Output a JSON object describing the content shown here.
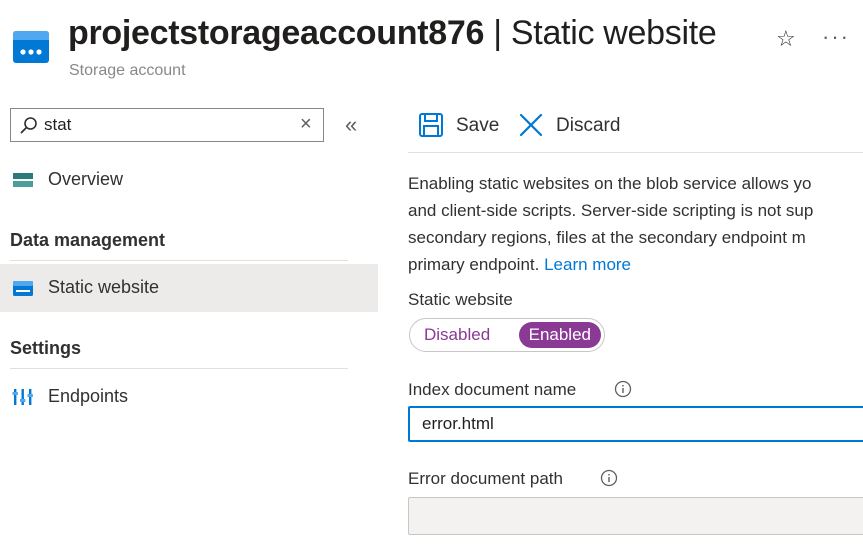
{
  "header": {
    "resource_name": "projectstorageaccount876",
    "separator": "|",
    "page_title": "Static website",
    "subtitle": "Storage account",
    "favorite_icon": "star-icon",
    "more_icon": "more-icon",
    "more_glyph": "···"
  },
  "sidebar": {
    "search": {
      "value": "stat",
      "icon": "search-icon"
    },
    "collapse_glyph": "«",
    "items": [
      {
        "label": "Overview",
        "icon": "overview-icon"
      },
      {
        "label": "Static website",
        "icon": "static-website-icon",
        "selected": true
      },
      {
        "label": "Endpoints",
        "icon": "endpoints-icon"
      }
    ],
    "groups": {
      "data": "Data management",
      "settings": "Settings"
    }
  },
  "toolbar": {
    "save_label": "Save",
    "discard_label": "Discard"
  },
  "main": {
    "description_lines": [
      "Enabling static websites on the blob service allows yo",
      "and client-side scripts. Server-side scripting is not sup",
      "secondary regions, files at the secondary endpoint m",
      "primary endpoint. "
    ],
    "learn_more": "Learn more",
    "static_website_label": "Static website",
    "toggle": {
      "off": "Disabled",
      "on": "Enabled",
      "selected": "Enabled"
    },
    "index_label": "Index document name",
    "index_value": "error.html",
    "error_label": "Error document path",
    "error_value": ""
  },
  "colors": {
    "accent": "#0078d4",
    "toggle_on": "#8a3a94",
    "selected_nav": "#edebe9"
  }
}
